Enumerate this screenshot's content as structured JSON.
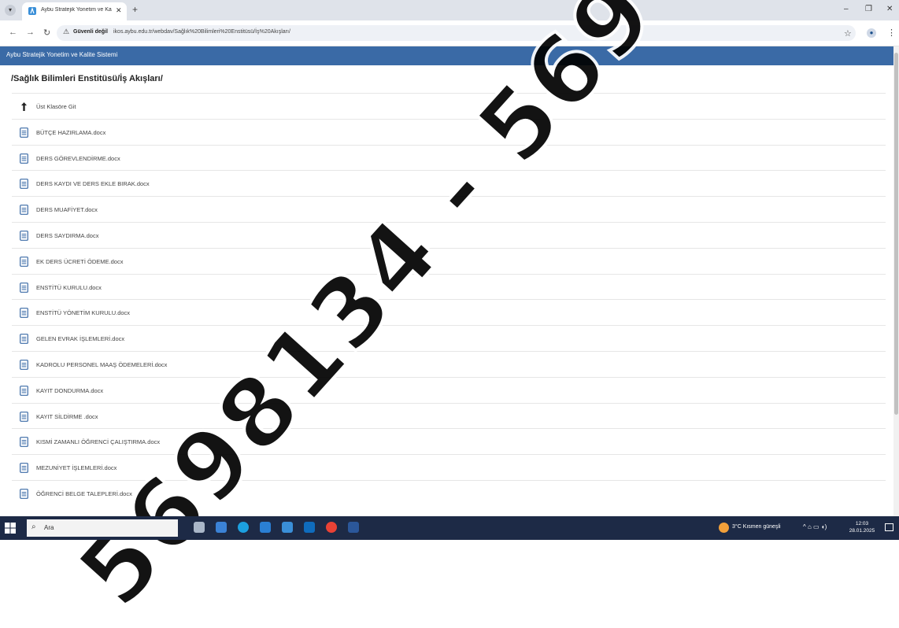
{
  "browser": {
    "tab_title": "Aybu Stratejik Yonetim ve Kalite",
    "tab_close": "✕",
    "new_tab": "+",
    "insecure_label": "Güvenli değil",
    "url": "ikos.aybu.edu.tr/webdav/Sağlık%20Bilimleri%20Enstitüsü/İş%20Akışları/",
    "minimize": "–",
    "restore": "❐",
    "close": "✕"
  },
  "app": {
    "title": "Aybu Stratejik Yonetim ve Kalite Sistemi",
    "path": "/Sağlık Bilimleri Enstitüsü/İş Akışları/"
  },
  "files": [
    {
      "label": "Üst Klasöre Git",
      "icon": "folder-up-icon"
    },
    {
      "label": "BÜTÇE HAZIRLAMA.docx",
      "icon": "document-icon"
    },
    {
      "label": "DERS GÖREVLENDİRME.docx",
      "icon": "document-icon"
    },
    {
      "label": "DERS KAYDI VE DERS EKLE BIRAK.docx",
      "icon": "document-icon"
    },
    {
      "label": "DERS MUAFİYET.docx",
      "icon": "document-icon"
    },
    {
      "label": "DERS SAYDIRMA.docx",
      "icon": "document-icon"
    },
    {
      "label": "EK DERS ÜCRETİ ÖDEME.docx",
      "icon": "document-icon"
    },
    {
      "label": "ENSTİTÜ KURULU.docx",
      "icon": "document-icon"
    },
    {
      "label": "ENSTİTÜ YÖNETİM KURULU.docx",
      "icon": "document-icon"
    },
    {
      "label": "GELEN EVRAK İŞLEMLERİ.docx",
      "icon": "document-icon"
    },
    {
      "label": "KADROLU PERSONEL MAAŞ ÖDEMELERİ.docx",
      "icon": "document-icon"
    },
    {
      "label": "KAYIT DONDURMA.docx",
      "icon": "document-icon"
    },
    {
      "label": "KAYIT SİLDİRME .docx",
      "icon": "document-icon"
    },
    {
      "label": "KISMİ ZAMANLI ÖĞRENCİ ÇALIŞTIRMA.docx",
      "icon": "document-icon"
    },
    {
      "label": "MEZUNİYET İŞLEMLERİ.docx",
      "icon": "document-icon"
    },
    {
      "label": "ÖĞRENCİ BELGE TALEPLERİ.docx",
      "icon": "document-icon"
    }
  ],
  "taskbar": {
    "search_placeholder": "Ara",
    "weather": "3°C  Kısmen güneşli",
    "time": "12:03",
    "date": "28.01.2025"
  },
  "watermark": "5698134 - 569",
  "colors": {
    "header_bg": "#3a6aa6",
    "taskbar_bg": "#1d2a46",
    "file_icon": "#3a6aa6"
  }
}
